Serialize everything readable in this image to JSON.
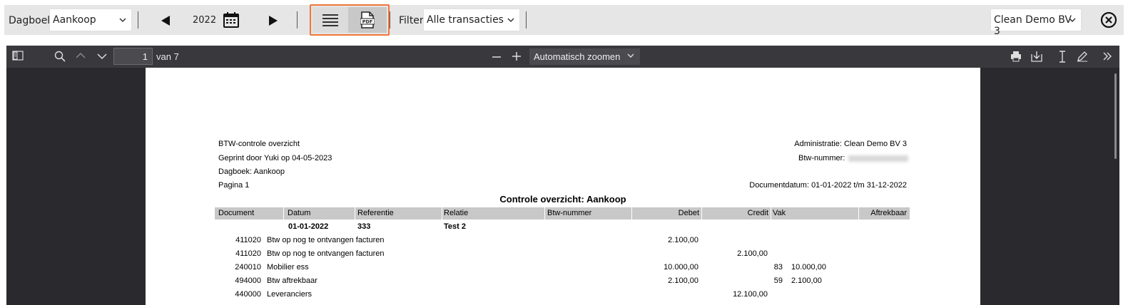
{
  "toolbar": {
    "dagboek_label": "Dagboek:",
    "dagboek_value": "Aankoop",
    "year": "2022",
    "filter_label": "Filter:",
    "filter_value": "Alle transacties",
    "company_value": "Clean Demo BV 3",
    "accent_color": "#f0763a",
    "icons": [
      "prev-arrow-icon",
      "calendar-icon",
      "next-arrow-icon",
      "list-view-icon",
      "pdf-icon",
      "close-circle-icon"
    ]
  },
  "pdf_viewer": {
    "page_number": "1",
    "page_total_label": "van 7",
    "zoom_value": "Automatisch zoomen",
    "icons": [
      "sidebar-toggle-icon",
      "search-icon",
      "page-up-icon",
      "page-down-icon",
      "zoom-out-icon",
      "zoom-in-icon",
      "print-icon",
      "download-icon",
      "text-cursor-icon",
      "draw-icon",
      "more-tools-icon"
    ]
  },
  "document": {
    "header_left": [
      "BTW-controle overzicht",
      "Geprint door Yuki op 04-05-2023",
      "Dagboek: Aankoop",
      "Pagina 1"
    ],
    "administratie": "Administratie: Clean Demo BV 3",
    "btw_nummer_label": "Btw-nummer:",
    "documentdatum": "Documentdatum: 01-01-2022 t/m 31-12-2022",
    "title": "Controle overzicht: Aankoop",
    "columns": [
      "Document",
      "Datum",
      "Referentie",
      "Relatie",
      "Btw-nummer",
      "Debet",
      "Credit",
      "Vak",
      "Aftrekbaar"
    ],
    "group": {
      "datum": "01-01-2022",
      "referentie": "333",
      "relatie": "Test 2"
    },
    "lines": [
      {
        "account": "411020",
        "description": "Btw op nog te ontvangen facturen",
        "debet": "2.100,00",
        "credit": "",
        "vak": "",
        "aftrekbaar": ""
      },
      {
        "account": "411020",
        "description": "Btw op nog te ontvangen facturen",
        "debet": "",
        "credit": "2.100,00",
        "vak": "",
        "aftrekbaar": ""
      },
      {
        "account": "240010",
        "description": "Mobilier ess",
        "debet": "10.000,00",
        "credit": "",
        "vak": "83",
        "aftrekbaar": "10.000,00"
      },
      {
        "account": "494000",
        "description": "Btw aftrekbaar",
        "debet": "2.100,00",
        "credit": "",
        "vak": "59",
        "aftrekbaar": "2.100,00"
      },
      {
        "account": "440000",
        "description": "Leveranciers",
        "debet": "",
        "credit": "12.100,00",
        "vak": "",
        "aftrekbaar": ""
      }
    ]
  }
}
